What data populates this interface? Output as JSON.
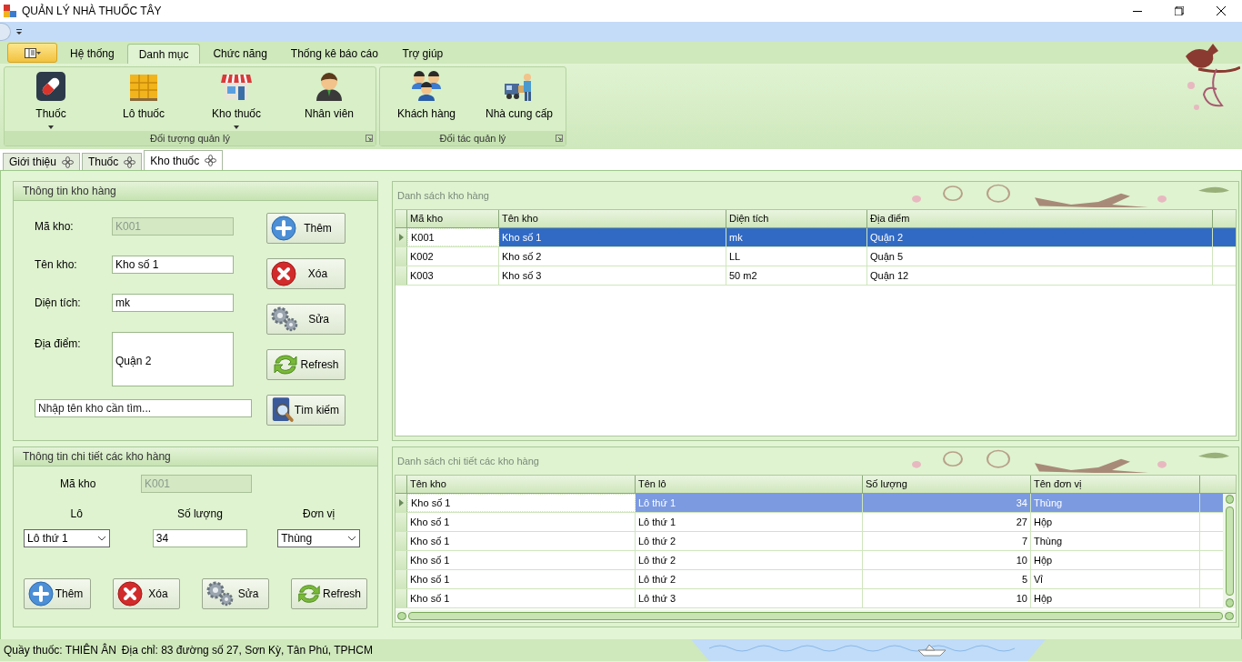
{
  "window": {
    "title": "QUẢN LÝ NHÀ THUỐC TÂY"
  },
  "ribbon": {
    "tabs": [
      {
        "label": "Hệ thống",
        "selected": false
      },
      {
        "label": "Danh mục",
        "selected": true
      },
      {
        "label": "Chức năng",
        "selected": false
      },
      {
        "label": "Thống kê báo cáo",
        "selected": false
      },
      {
        "label": "Trợ giúp",
        "selected": false
      }
    ],
    "groups": [
      {
        "title": "Đối tượng quản lý",
        "items": [
          {
            "label": "Thuốc",
            "kind": "pill",
            "dropdown": true
          },
          {
            "label": "Lô thuốc",
            "kind": "boxes",
            "dropdown": false
          },
          {
            "label": "Kho thuốc",
            "kind": "store",
            "dropdown": true
          },
          {
            "label": "Nhân viên",
            "kind": "person",
            "dropdown": false
          }
        ]
      },
      {
        "title": "Đối tác quản lý",
        "items": [
          {
            "label": "Khách hàng",
            "kind": "people",
            "dropdown": false
          },
          {
            "label": "Nhà cung cấp",
            "kind": "truck",
            "dropdown": false
          }
        ]
      }
    ]
  },
  "doc_tabs": [
    {
      "label": "Giới thiệu",
      "selected": false
    },
    {
      "label": "Thuốc",
      "selected": false
    },
    {
      "label": "Kho thuốc",
      "selected": true
    }
  ],
  "warehouse_form": {
    "title": "Thông tin kho hàng",
    "fields": [
      {
        "label": "Mã kho:",
        "value": "K001",
        "disabled": true,
        "kind": "line"
      },
      {
        "label": "Tên kho:",
        "value": "Kho số 1",
        "disabled": false,
        "kind": "line"
      },
      {
        "label": "Diện tích:",
        "value": "mk",
        "disabled": false,
        "kind": "line"
      },
      {
        "label": "Địa điểm:",
        "value": "Quận 2",
        "disabled": false,
        "kind": "multiline"
      }
    ],
    "search": {
      "placeholder": "Nhập tên kho cần tìm..."
    },
    "buttons": [
      {
        "label": "Thêm",
        "kind": "add"
      },
      {
        "label": "Xóa",
        "kind": "delete"
      },
      {
        "label": "Sửa",
        "kind": "edit"
      },
      {
        "label": "Refresh",
        "kind": "refresh"
      },
      {
        "label": "Tìm kiếm",
        "kind": "search"
      }
    ]
  },
  "detail_form": {
    "title": "Thông tin chi tiết các kho hàng",
    "code": {
      "label": "Mã kho",
      "value": "K001",
      "disabled": true
    },
    "lot": {
      "label": "Lô",
      "value": "Lô thứ 1"
    },
    "quantity": {
      "label": "Số lượng",
      "value": "34"
    },
    "unit": {
      "label": "Đơn vị",
      "value": "Thùng"
    },
    "buttons": [
      {
        "label": "Thêm",
        "kind": "add"
      },
      {
        "label": "Xóa",
        "kind": "delete"
      },
      {
        "label": "Sửa",
        "kind": "edit"
      },
      {
        "label": "Refresh",
        "kind": "refresh"
      }
    ]
  },
  "warehouse_list": {
    "title": "Danh sách kho hàng",
    "columns": [
      {
        "label": "Mã kho",
        "kind": "text"
      },
      {
        "label": "Tên kho",
        "kind": "text"
      },
      {
        "label": "Diện tích",
        "kind": "text"
      },
      {
        "label": "Địa điểm",
        "kind": "text"
      }
    ],
    "rows": [
      {
        "selected": true,
        "cells": [
          "K001",
          "Kho số 1",
          "mk",
          "Quận 2"
        ]
      },
      {
        "selected": false,
        "cells": [
          "K002",
          "Kho số 2",
          "LL",
          "Quận 5"
        ]
      },
      {
        "selected": false,
        "cells": [
          "K003",
          "Kho số 3",
          "50 m2",
          "Quận 12"
        ]
      }
    ]
  },
  "detail_list": {
    "title": "Danh sách chi tiết các kho hàng",
    "columns": [
      {
        "label": "Tên kho",
        "kind": "text"
      },
      {
        "label": "Tên lô",
        "kind": "text"
      },
      {
        "label": "Số lượng",
        "kind": "number"
      },
      {
        "label": "Tên đơn vị",
        "kind": "text"
      }
    ],
    "rows": [
      {
        "selected": true,
        "cells": [
          "Kho số 1",
          "Lô thứ 1",
          "34",
          "Thùng"
        ]
      },
      {
        "selected": false,
        "cells": [
          "Kho số 1",
          "Lô thứ 1",
          "27",
          "Hộp"
        ]
      },
      {
        "selected": false,
        "cells": [
          "Kho số 1",
          "Lô thứ 2",
          "7",
          "Thùng"
        ]
      },
      {
        "selected": false,
        "cells": [
          "Kho số 1",
          "Lô thứ 2",
          "10",
          "Hộp"
        ]
      },
      {
        "selected": false,
        "cells": [
          "Kho số 1",
          "Lô thứ 2",
          "5",
          "Vỉ"
        ]
      },
      {
        "selected": false,
        "cells": [
          "Kho số 1",
          "Lô thứ 3",
          "10",
          "Hộp"
        ]
      }
    ]
  },
  "status_bar": {
    "items": [
      "Quầy thuốc: THIÊN ÂN",
      "Địa chỉ: 83 đường số 27, Sơn Kỳ, Tân Phú, TPHCM"
    ]
  }
}
